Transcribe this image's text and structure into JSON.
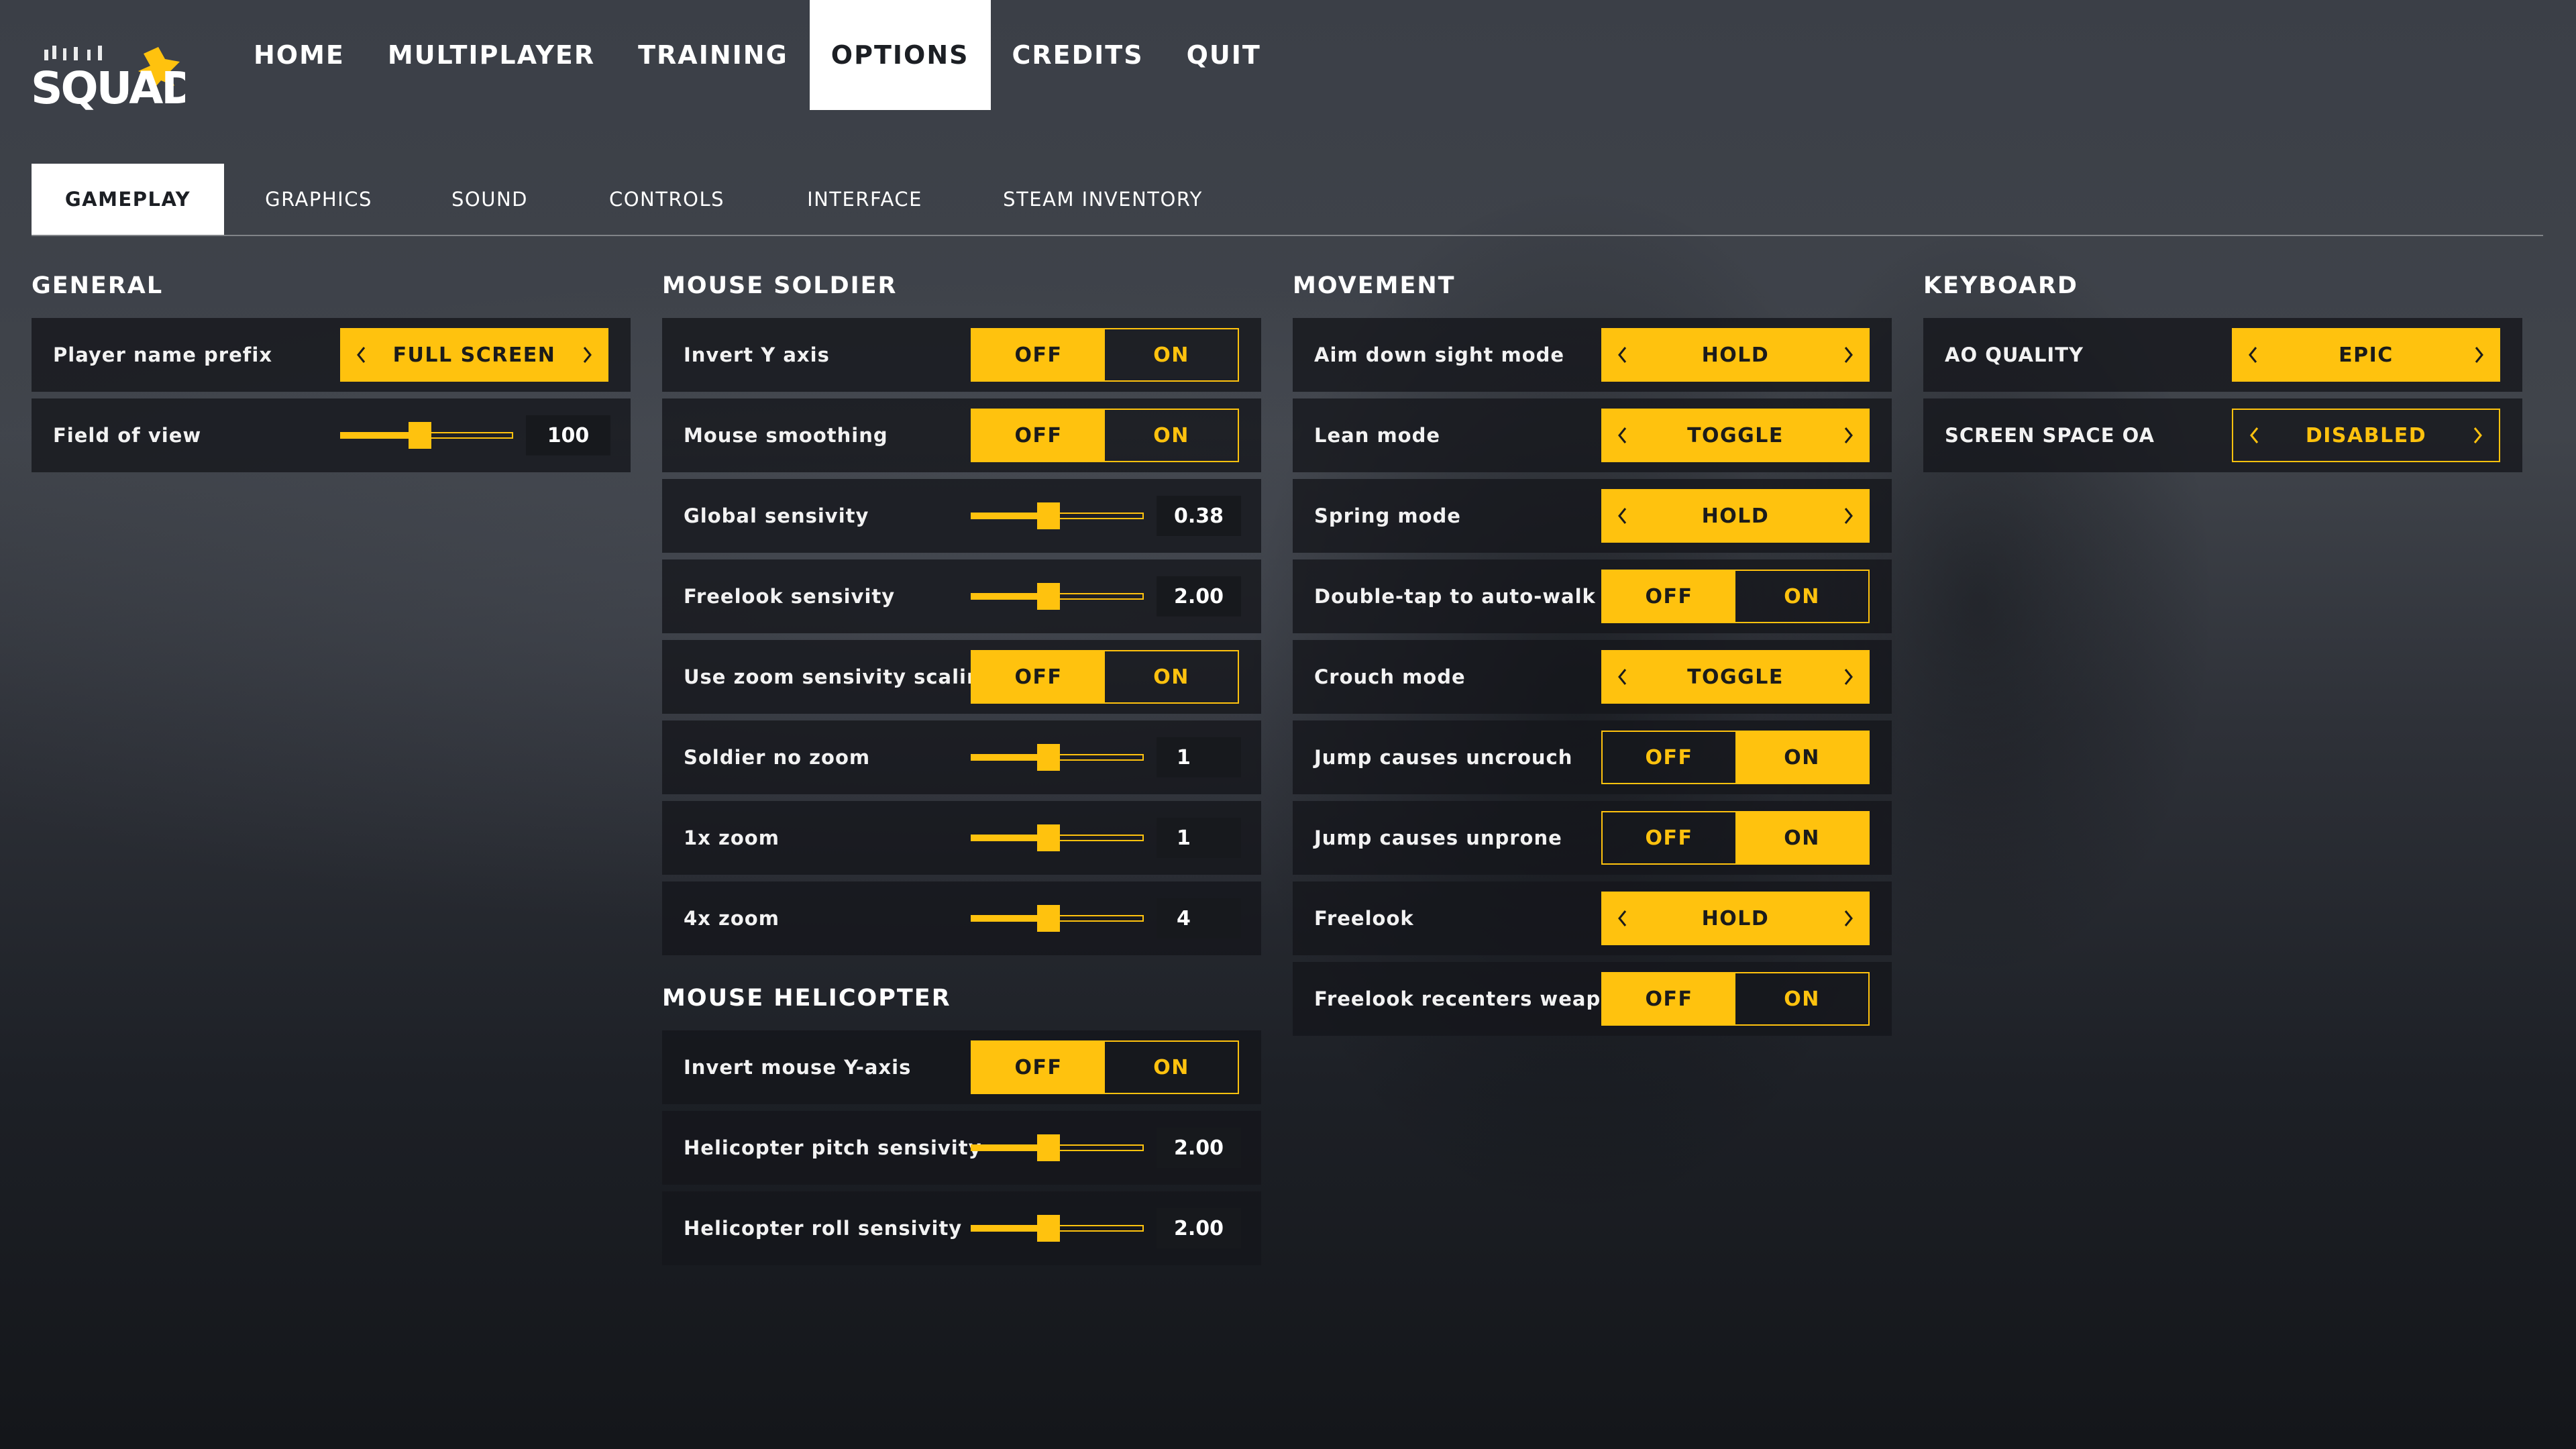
{
  "logo": {
    "text": "SQUAD"
  },
  "topnav": {
    "items": [
      "HOME",
      "MULTIPLAYER",
      "TRAINING",
      "OPTIONS",
      "CREDITS",
      "QUIT"
    ],
    "active": "OPTIONS"
  },
  "tabs": {
    "items": [
      "GAMEPLAY",
      "GRAPHICS",
      "SOUND",
      "CONTROLS",
      "INTERFACE",
      "STEAM INVENTORY"
    ],
    "active": "GAMEPLAY"
  },
  "colors": {
    "accent": "#ffc20e",
    "row_bg": "#14161b",
    "active_tab": "#ffffff"
  },
  "icons": {
    "prev": "chevron-left-icon",
    "next": "chevron-right-icon"
  },
  "general": {
    "title": "GENERAL",
    "player_name_prefix": {
      "label": "Player name prefix",
      "value": "FULL SCREEN"
    },
    "field_of_view": {
      "label": "Field of view",
      "value": "100",
      "fraction": 0.46
    }
  },
  "mouse_soldier": {
    "title": "MOUSE SOLDIER",
    "invert_y": {
      "label": "Invert Y axis",
      "off": "OFF",
      "on": "ON",
      "selected": "OFF"
    },
    "mouse_smoothing": {
      "label": "Mouse smoothing",
      "off": "OFF",
      "on": "ON",
      "selected": "OFF"
    },
    "global_sens": {
      "label": "Global sensivity",
      "value": "0.38",
      "fraction": 0.45
    },
    "freelook_sens": {
      "label": "Freelook sensivity",
      "value": "2.00",
      "fraction": 0.45
    },
    "zoom_scaling": {
      "label": "Use zoom sensivity scaling",
      "off": "OFF",
      "on": "ON",
      "selected": "OFF"
    },
    "soldier_no_zoom": {
      "label": "Soldier no zoom",
      "value": "1",
      "fraction": 0.45
    },
    "zoom_1x": {
      "label": "1x zoom",
      "value": "1",
      "fraction": 0.45
    },
    "zoom_4x": {
      "label": "4x zoom",
      "value": "4",
      "fraction": 0.45
    }
  },
  "mouse_helicopter": {
    "title": "MOUSE HELICOPTER",
    "invert_y": {
      "label": "Invert mouse Y-axis",
      "off": "OFF",
      "on": "ON",
      "selected": "OFF"
    },
    "pitch_sens": {
      "label": "Helicopter pitch sensivity",
      "value": "2.00",
      "fraction": 0.45
    },
    "roll_sens": {
      "label": "Helicopter roll sensivity",
      "value": "2.00",
      "fraction": 0.45
    }
  },
  "movement": {
    "title": "MOVEMENT",
    "ads_mode": {
      "label": "Aim down sight mode",
      "value": "HOLD"
    },
    "lean_mode": {
      "label": "Lean mode",
      "value": "TOGGLE"
    },
    "spring_mode": {
      "label": "Spring mode",
      "value": "HOLD"
    },
    "double_tap": {
      "label": "Double-tap to auto-walk",
      "off": "OFF",
      "on": "ON",
      "selected": "OFF"
    },
    "crouch_mode": {
      "label": "Crouch mode",
      "value": "TOGGLE"
    },
    "jump_uncrouch": {
      "label": "Jump causes uncrouch",
      "off": "OFF",
      "on": "ON",
      "selected": "ON"
    },
    "jump_unprone": {
      "label": "Jump causes unprone",
      "off": "OFF",
      "on": "ON",
      "selected": "ON"
    },
    "freelook": {
      "label": "Freelook",
      "value": "HOLD"
    },
    "freelook_recenter": {
      "label": "Freelook recenters weapon",
      "off": "OFF",
      "on": "ON",
      "selected": "OFF"
    }
  },
  "keyboard": {
    "title": "KEYBOARD",
    "ao_quality": {
      "label": "AO QUALITY",
      "value": "EPIC"
    },
    "ssao": {
      "label": "SCREEN SPACE OA",
      "value": "DISABLED"
    }
  }
}
